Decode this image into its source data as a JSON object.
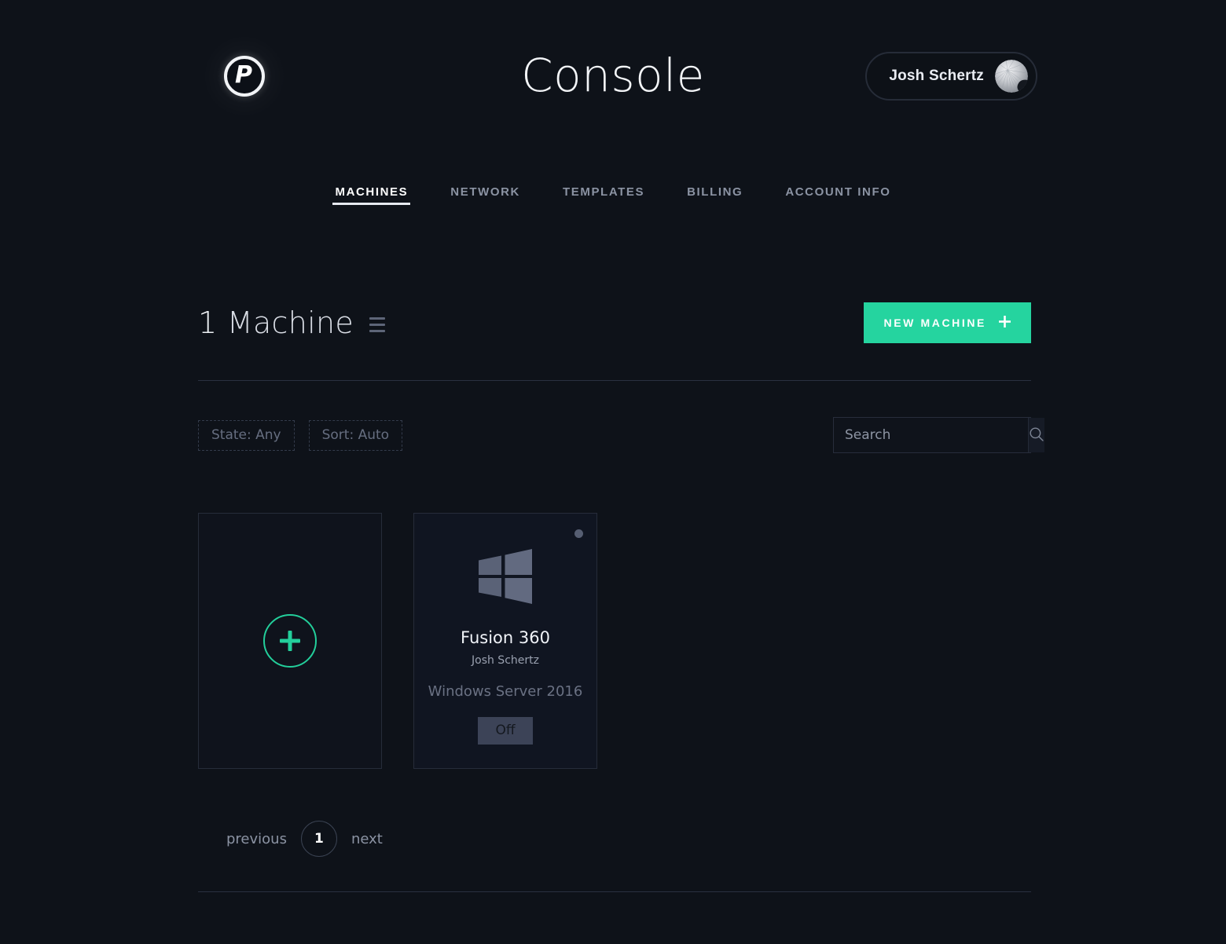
{
  "header": {
    "logo_letter": "P",
    "logo_icon": "paperspace-logo-icon",
    "title": "Console",
    "user": {
      "name": "Josh Schertz",
      "avatar_icon": "user-avatar"
    }
  },
  "nav": {
    "tabs": [
      {
        "label": "MACHINES",
        "active": true
      },
      {
        "label": "NETWORK",
        "active": false
      },
      {
        "label": "TEMPLATES",
        "active": false
      },
      {
        "label": "BILLING",
        "active": false
      },
      {
        "label": "ACCOUNT INFO",
        "active": false
      }
    ]
  },
  "list_header": {
    "count": "1",
    "count_label": "Machine",
    "view_toggle_icon": "list-view-icon",
    "new_machine_label": "NEW MACHINE",
    "new_machine_plus": "✛"
  },
  "filters": {
    "state_chip": "State: Any",
    "sort_chip": "Sort: Auto",
    "search": {
      "placeholder": "Search",
      "value": "",
      "icon": "search-icon"
    }
  },
  "machines": {
    "add_card": {
      "icon": "plus-circle-icon"
    },
    "items": [
      {
        "name": "Fusion 360",
        "owner": "Josh Schertz",
        "os": "Windows Server 2016",
        "os_icon": "windows-logo-icon",
        "state": "Off",
        "status_dot": "status-dot-off"
      }
    ]
  },
  "pagination": {
    "previous": "previous",
    "current_page": "1",
    "next": "next"
  },
  "colors": {
    "background": "#0e1219",
    "accent_green": "#25d49f",
    "card_border": "#262c3a",
    "muted_text": "#6a7183",
    "badge_off": "#3c4357",
    "windows_logo": "#5c6479"
  }
}
